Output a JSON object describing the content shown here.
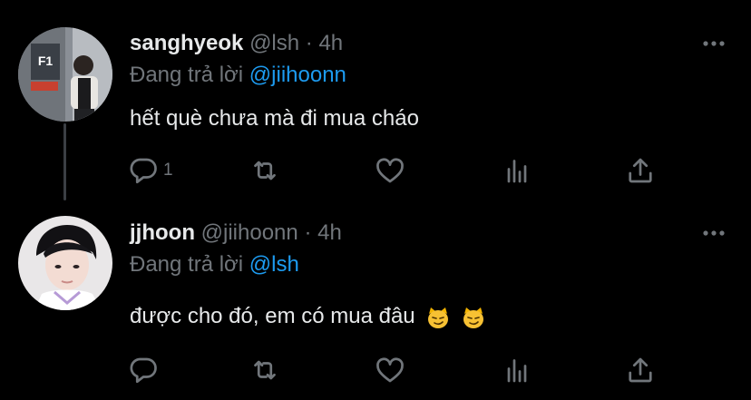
{
  "tweets": [
    {
      "display_name": "sanghyeok",
      "handle": "@lsh",
      "separator": "·",
      "time": "4h",
      "replying_prefix": "Đang trả lời",
      "replying_to": "@jiihoonn",
      "text": "hết què chưa mà đi mua cháo",
      "reply_count": "1",
      "avatar_icon": "avatar-photo-sanghyeok"
    },
    {
      "display_name": "jjhoon",
      "handle": "@jiihoonn",
      "separator": "·",
      "time": "4h",
      "replying_prefix": "Đang trả lời",
      "replying_to": "@lsh",
      "text": "được cho đó, em có mua đâu",
      "reply_count": "",
      "emojis": [
        "smirking-cat-emoji",
        "smirking-cat-emoji"
      ],
      "avatar_icon": "avatar-photo-jjhoon"
    }
  ],
  "icons": {
    "reply": "reply-icon",
    "retweet": "retweet-icon",
    "like": "like-icon",
    "analytics": "analytics-icon",
    "share": "share-icon",
    "more": "more-options-icon"
  },
  "colors": {
    "background": "#000000",
    "primary_text": "#e7e9ea",
    "secondary_text": "#71767b",
    "mention": "#1d9bf0",
    "thread_line": "#3b3f44"
  }
}
